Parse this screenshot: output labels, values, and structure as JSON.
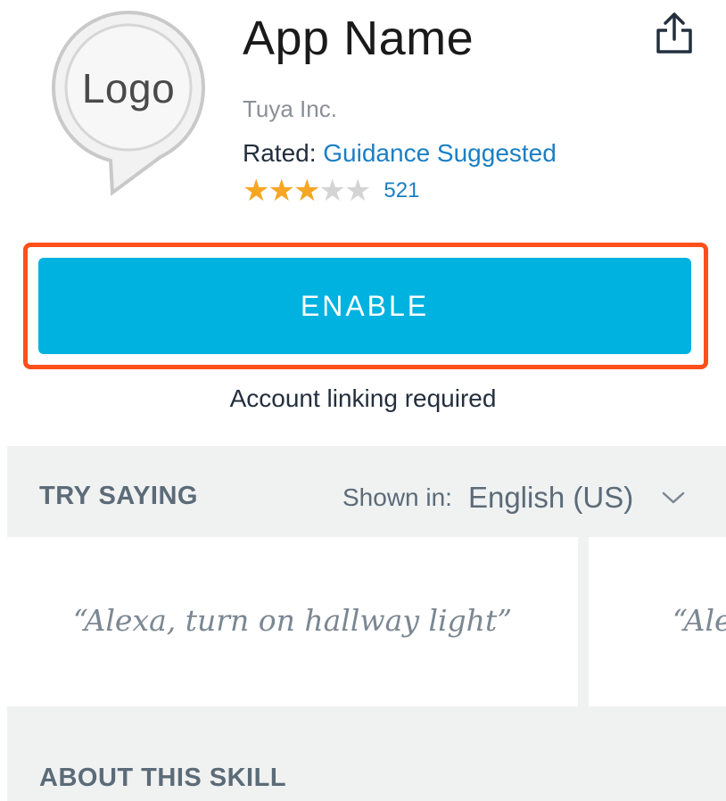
{
  "header": {
    "logo_text": "Logo",
    "app_name": "App Name",
    "developer": "Tuya Inc.",
    "rated_label": "Rated:",
    "rated_value": "Guidance Suggested",
    "rating": {
      "stars": 3,
      "max": 5,
      "count": "521"
    },
    "share_icon": "share-icon"
  },
  "enable": {
    "label": "ENABLE",
    "note": "Account linking required"
  },
  "try_saying": {
    "heading": "TRY SAYING",
    "shown_in_label": "Shown in:",
    "language": "English (US)",
    "utterances": [
      "“Alexa, turn on hallway light”",
      "“Ale"
    ]
  },
  "about": {
    "heading": "ABOUT THIS SKILL"
  },
  "colors": {
    "accent_blue": "#00b2e0",
    "link_blue": "#1a7fc4",
    "highlight_outline": "#ff4f1a",
    "star_on": "#f5a623",
    "star_off": "#d4d4d4",
    "section_gray": "#f0f1f1"
  }
}
